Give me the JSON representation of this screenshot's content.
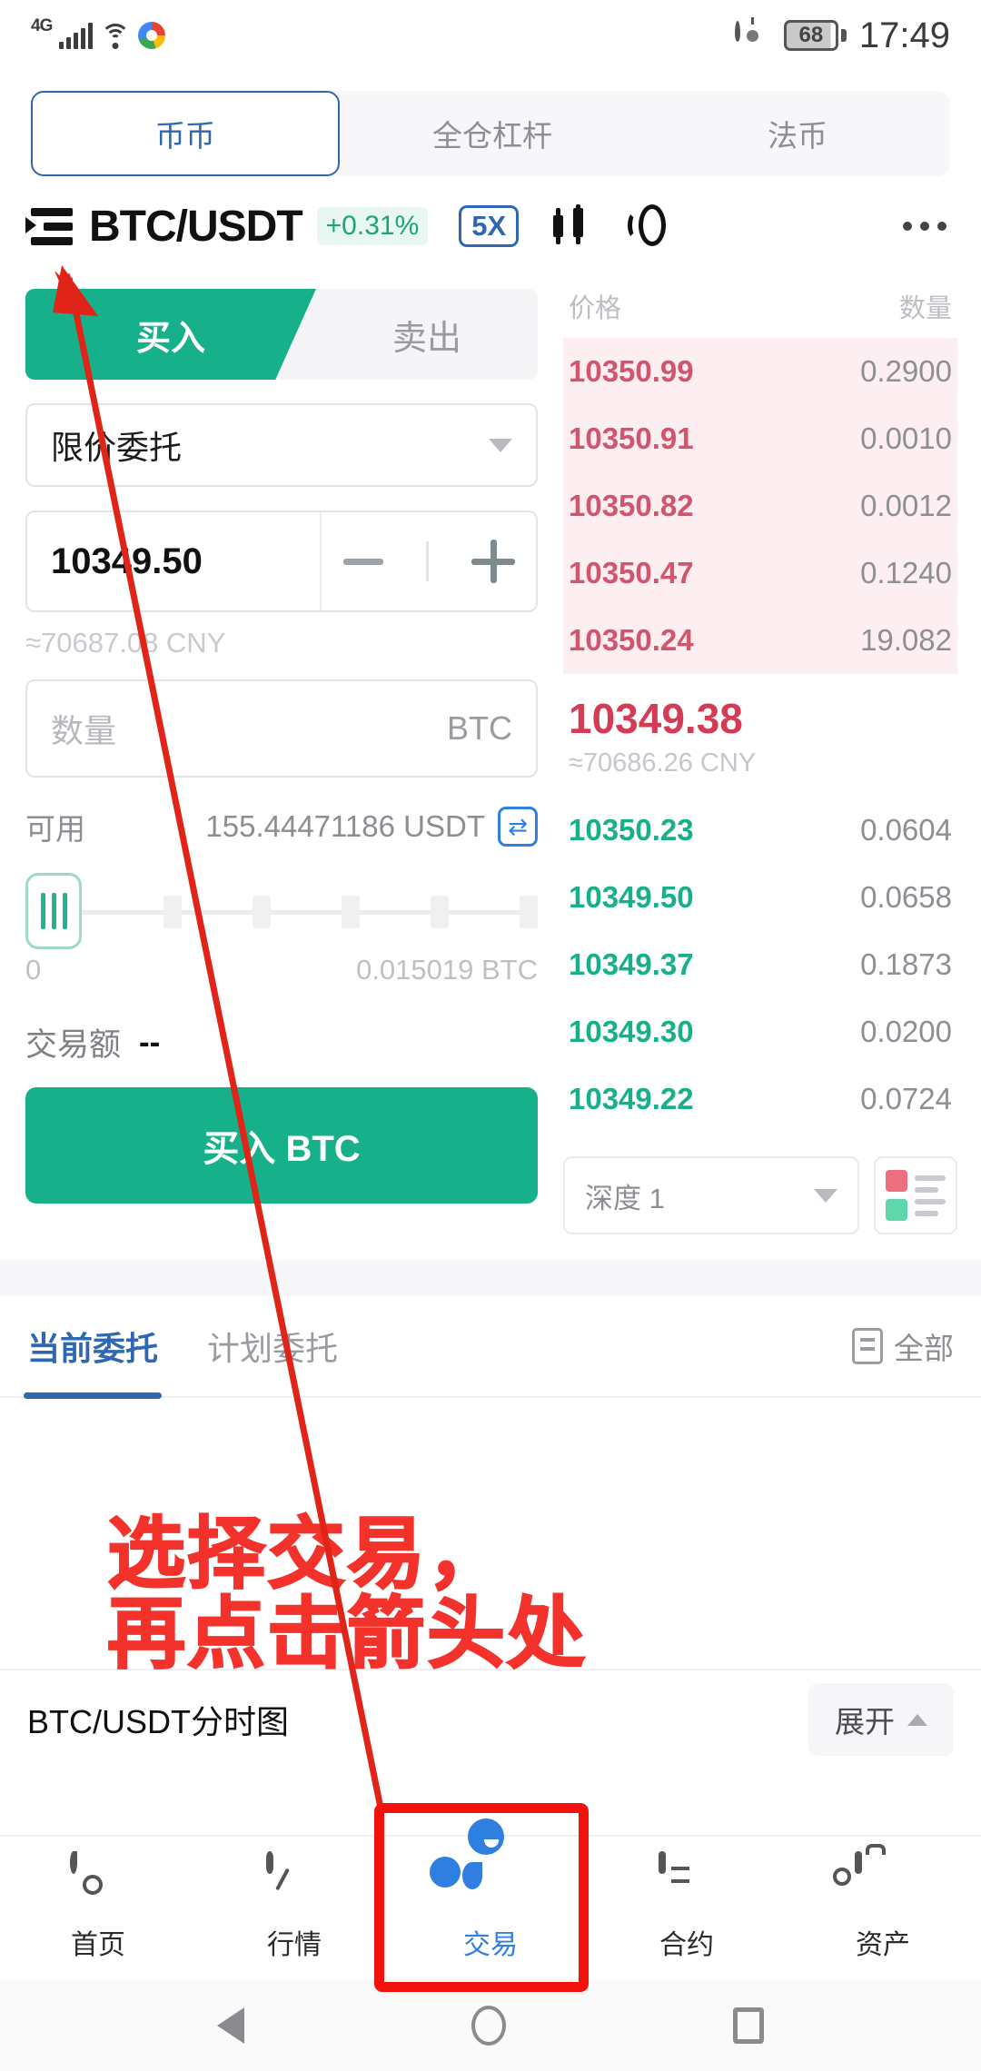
{
  "status_bar": {
    "network": "4G",
    "battery_level": "68",
    "time": "17:49",
    "icons": [
      "signal-bars-icon",
      "wifi-icon",
      "chrome-icon",
      "eye-icon",
      "battery-icon"
    ]
  },
  "top_tabs": [
    {
      "label": "币币",
      "active": true
    },
    {
      "label": "全仓杠杆",
      "active": false
    },
    {
      "label": "法币",
      "active": false
    }
  ],
  "symbol_header": {
    "pair": "BTC/USDT",
    "change": "+0.31%",
    "leverage": "5X",
    "accent_blue": "#2f67b0",
    "accent_green": "#16b08a",
    "accent_red": "#d43b54"
  },
  "trade_form": {
    "buy_tab": "买入",
    "sell_tab": "卖出",
    "order_type": "限价委托",
    "price_value": "10349.50",
    "price_cny": "≈70687.08 CNY",
    "qty_placeholder": "数量",
    "qty_unit": "BTC",
    "available_label": "可用",
    "available_value": "155.44471186 USDT",
    "slider_min": "0",
    "slider_max": "0.015019 BTC",
    "amount_label": "交易额",
    "amount_value": "--",
    "submit_label": "买入 BTC"
  },
  "order_book": {
    "col_price": "价格",
    "col_amount": "数量",
    "asks": [
      {
        "price": "10350.99",
        "amount": "0.2900"
      },
      {
        "price": "10350.91",
        "amount": "0.0010"
      },
      {
        "price": "10350.82",
        "amount": "0.0012"
      },
      {
        "price": "10350.47",
        "amount": "0.1240"
      },
      {
        "price": "10350.24",
        "amount": "19.082"
      }
    ],
    "mid_price": "10349.38",
    "mid_cny": "≈70686.26 CNY",
    "bids": [
      {
        "price": "10350.23",
        "amount": "0.0604"
      },
      {
        "price": "10349.50",
        "amount": "0.0658"
      },
      {
        "price": "10349.37",
        "amount": "0.1873"
      },
      {
        "price": "10349.30",
        "amount": "0.0200"
      },
      {
        "price": "10349.22",
        "amount": "0.0724"
      }
    ],
    "depth_label": "深度 1"
  },
  "orders_section": {
    "tabs": [
      {
        "label": "当前委托",
        "active": true
      },
      {
        "label": "计划委托",
        "active": false
      }
    ],
    "all_label": "全部"
  },
  "chart_bar": {
    "label": "BTC/USDT分时图",
    "expand_label": "展开"
  },
  "bottom_nav": [
    {
      "label": "首页",
      "icon": "flame-icon",
      "active": false
    },
    {
      "label": "行情",
      "icon": "market-arrow-icon",
      "active": false
    },
    {
      "label": "交易",
      "icon": "trade-icon",
      "active": true
    },
    {
      "label": "合约",
      "icon": "contract-icon",
      "active": false
    },
    {
      "label": "资产",
      "icon": "wallet-icon",
      "active": false
    }
  ],
  "annotation": {
    "line1": "选择交易，",
    "line2": "再点击箭头处",
    "color": "#f2322b"
  }
}
